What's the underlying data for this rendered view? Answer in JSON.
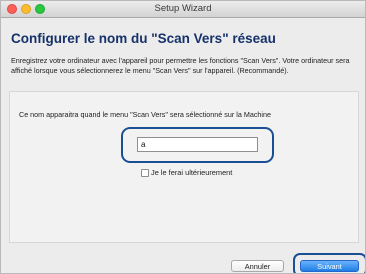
{
  "window": {
    "title": "Setup Wizard"
  },
  "header": {
    "title": "Configurer le nom du \"Scan Vers\" réseau",
    "description": "Enregistrez votre ordinateur avec l'appareil pour permettre les fonctions \"Scan Vers\". Votre ordinateur sera affiché lorsque vous sélectionnerez le menu \"Scan Vers\" sur l'appareil. (Recommandé)."
  },
  "form": {
    "prompt": "Ce nom apparaitra quand le menu \"Scan Vers\" sera sélectionné sur la Machine",
    "name_value": "a",
    "later_checkbox_label": "Je le ferai ultérieurement",
    "later_checked": false
  },
  "buttons": {
    "cancel": "Annuler",
    "next": "Suivant"
  },
  "colors": {
    "accent": "#1e7fe6",
    "title": "#16326b",
    "highlight": "#1a4f93"
  }
}
